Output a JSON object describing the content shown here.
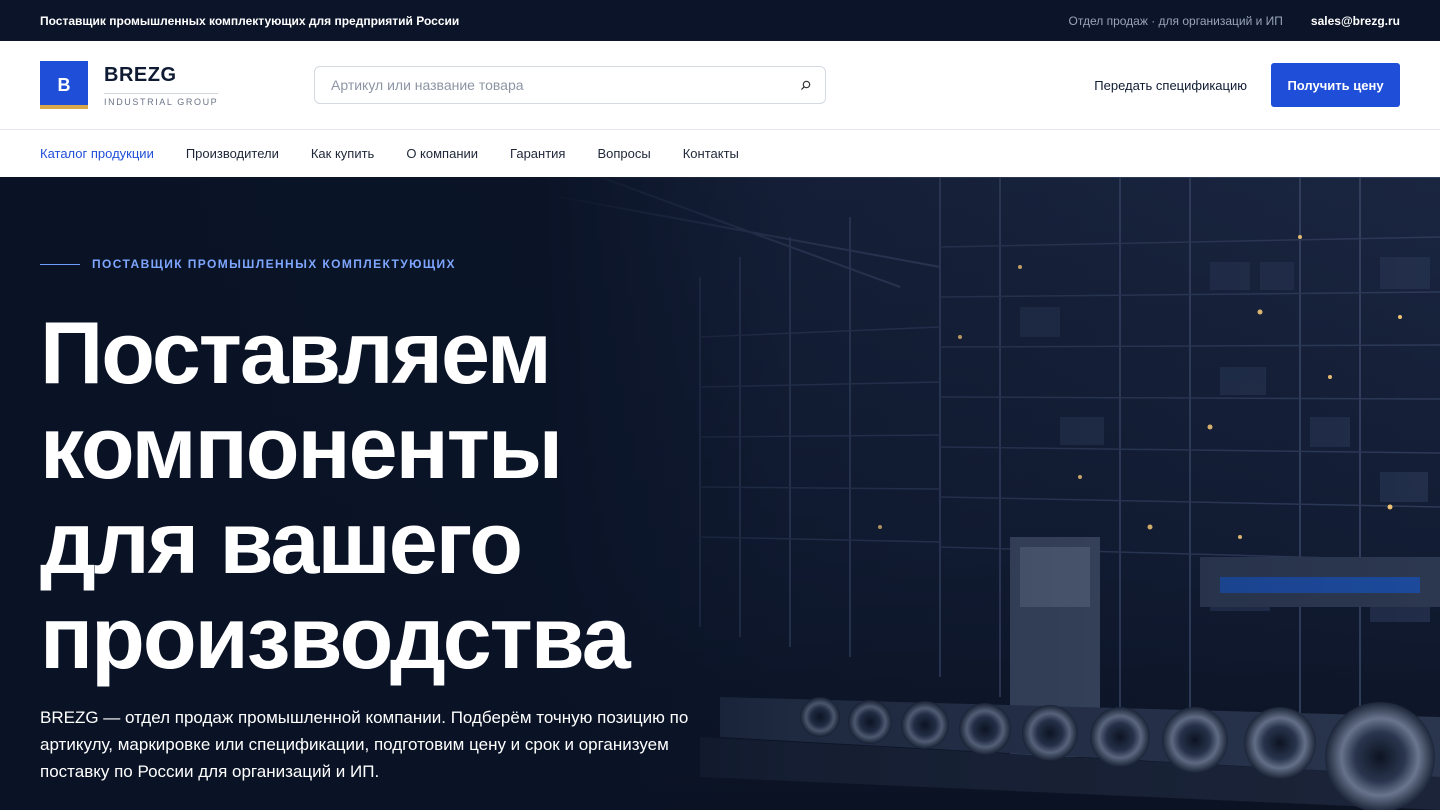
{
  "topbar": {
    "tagline": "Поставщик промышленных комплектующих для предприятий России",
    "sales_note": "Отдел продаж · для организаций и ИП",
    "email": "sales@brezg.ru"
  },
  "header": {
    "logo_letter": "B",
    "logo_name": "BREZG",
    "logo_sub": "INDUSTRIAL GROUP",
    "search_placeholder": "Артикул или название товара",
    "spec_link": "Передать спецификацию",
    "price_button": "Получить цену"
  },
  "nav": {
    "items": [
      {
        "label": "Каталог продукции"
      },
      {
        "label": "Производители"
      },
      {
        "label": "Как купить"
      },
      {
        "label": "О компании"
      },
      {
        "label": "Гарантия"
      },
      {
        "label": "Вопросы"
      },
      {
        "label": "Контакты"
      }
    ]
  },
  "hero": {
    "eyebrow": "ПОСТАВЩИК ПРОМЫШЛЕННЫХ КОМПЛЕКТУЮЩИХ",
    "headline_lines": [
      "Поставляем",
      "компоненты",
      "для вашего",
      "производства"
    ],
    "lead": "BREZG — отдел продаж промышленной компании. Подберём точную позицию по артикулу, маркировке или спецификации, подготовим цену и срок и организуем поставку по России для организаций и ИП."
  },
  "colors": {
    "accent": "#1f4fd8",
    "topbar_bg": "#0b1428",
    "hero_bg": "#0a1326",
    "logo_stripe": "#d7a94a"
  }
}
